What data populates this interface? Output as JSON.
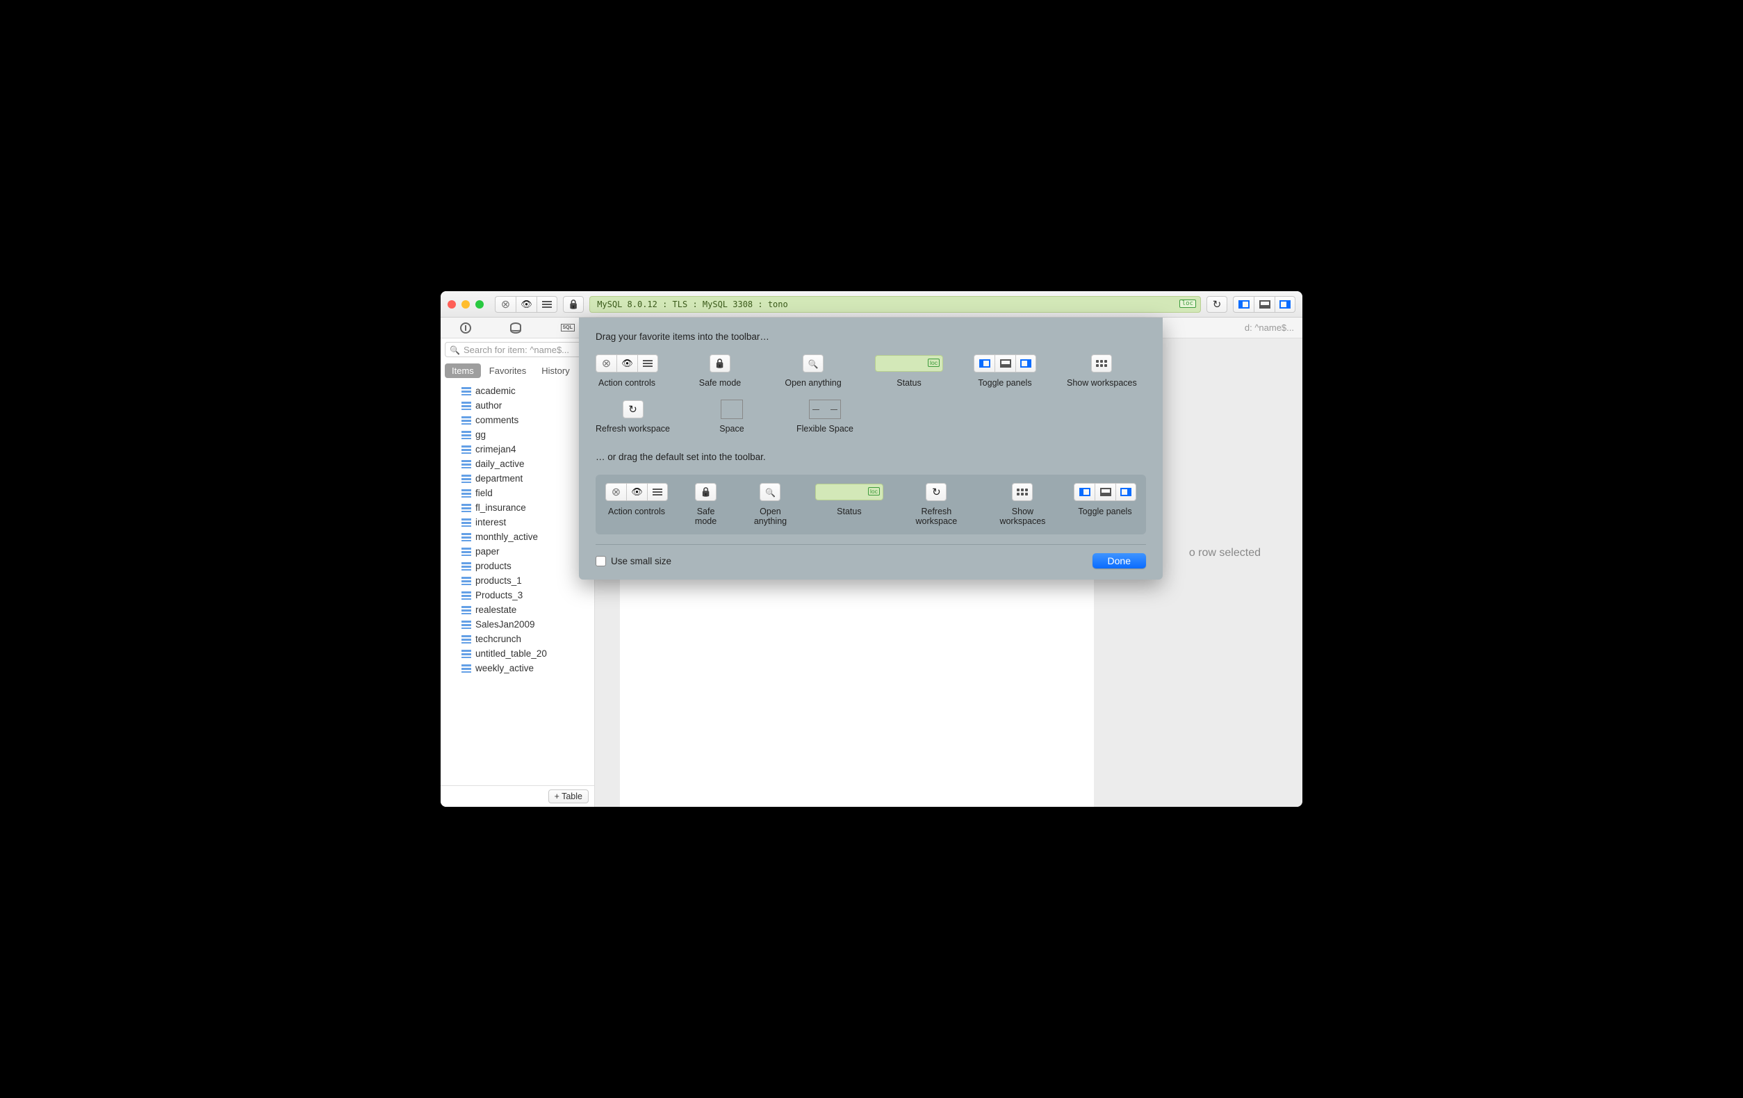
{
  "toolbar": {
    "status_text": "MySQL 8.0.12 : TLS : MySQL 3308 : tono",
    "loc_badge": "loc"
  },
  "sidebar": {
    "search_placeholder": "Search for item: ^name$...",
    "right_placeholder": "d: ^name$...",
    "tabs": {
      "items": "Items",
      "favorites": "Favorites",
      "history": "History"
    },
    "add_label": "+ Table",
    "tables": [
      "academic",
      "author",
      "comments",
      "gg",
      "crimejan4",
      "daily_active",
      "department",
      "field",
      "fl_insurance",
      "interest",
      "monthly_active",
      "paper",
      "products",
      "products_1",
      "Products_3",
      "realestate",
      "SalesJan2009",
      "techcrunch",
      "untitled_table_20",
      "weekly_active"
    ]
  },
  "content": {
    "no_row": "o row selected"
  },
  "customize": {
    "heading1": "Drag your favorite items into the toolbar…",
    "heading2": "… or drag the default set into the toolbar.",
    "items": {
      "action_controls": "Action controls",
      "safe_mode": "Safe mode",
      "open_anything": "Open anything",
      "status": "Status",
      "toggle_panels": "Toggle panels",
      "show_workspaces": "Show workspaces",
      "refresh_workspace": "Refresh workspace",
      "space": "Space",
      "flexible_space": "Flexible Space"
    },
    "small_size": "Use small size",
    "done": "Done"
  }
}
